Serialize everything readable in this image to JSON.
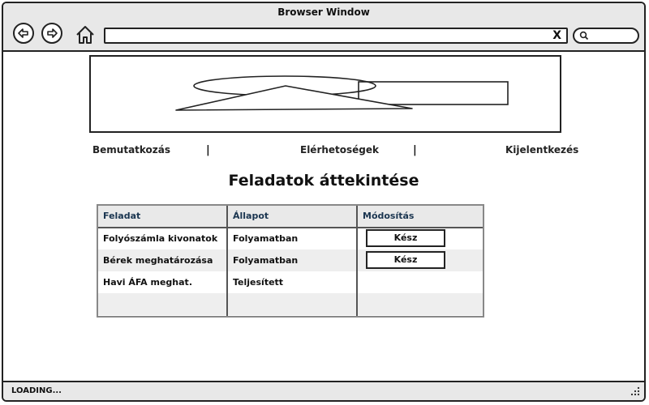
{
  "window": {
    "title": "Browser Window"
  },
  "addressbar": {
    "url": "",
    "clear_label": "X"
  },
  "nav": {
    "links": [
      "Bemutatkozás",
      "Elérhetoségek",
      "Kijelentkezés"
    ],
    "separator": "|"
  },
  "page": {
    "heading": "Feladatok áttekintése"
  },
  "table": {
    "headers": [
      "Feladat",
      "Állapot",
      "Módosítás"
    ],
    "rows": [
      {
        "task": "Folyószámla kivonatok",
        "status": "Folyamatban",
        "action": "Kész"
      },
      {
        "task": "Bérek meghatározása",
        "status": "Folyamatban",
        "action": "Kész"
      },
      {
        "task": "Havi ÁFA meghat.",
        "status": "Teljesített",
        "action": ""
      },
      {
        "task": "",
        "status": "",
        "action": ""
      }
    ]
  },
  "statusbar": {
    "text": "LOADING..."
  },
  "icons": {
    "back": "back-arrow-icon",
    "forward": "forward-arrow-icon",
    "home": "home-icon",
    "search": "search-icon",
    "resize": "resize-grip-icon",
    "banner": "image-placeholder-icon"
  }
}
